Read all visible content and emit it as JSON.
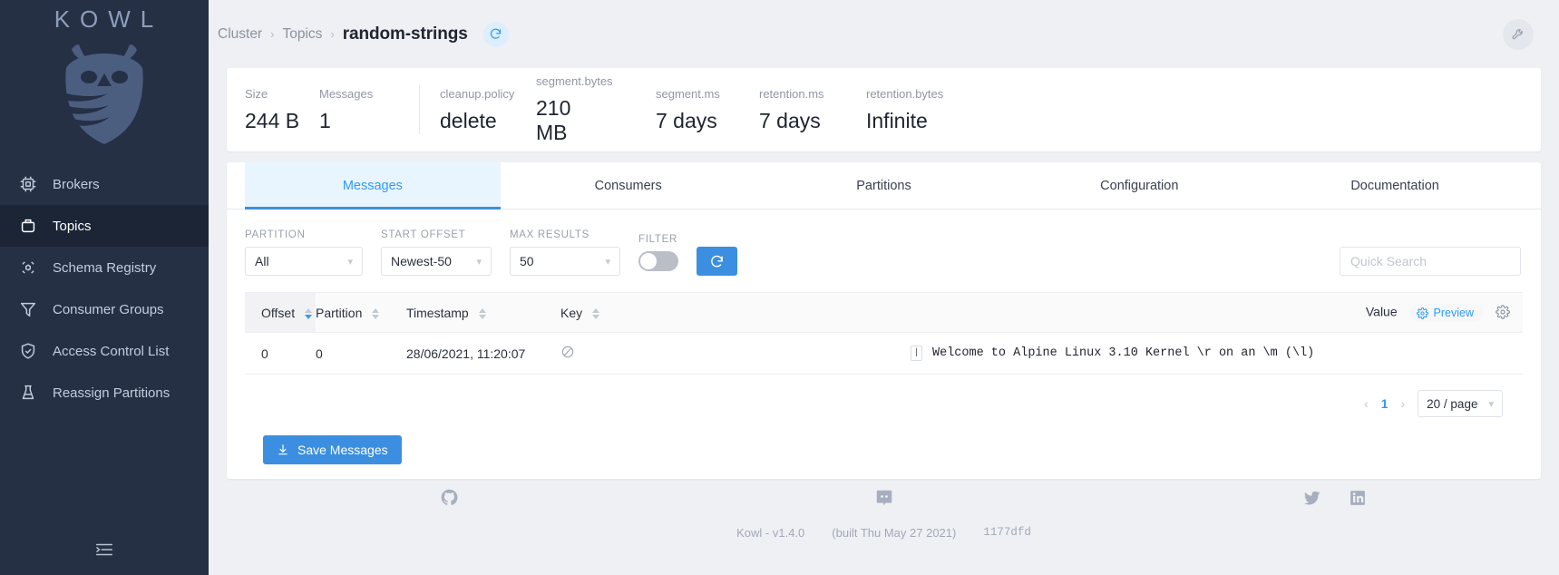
{
  "sidebar": {
    "logo_text": "KOWL",
    "logo_icon": "owl-shield-logo",
    "items": [
      {
        "label": "Brokers",
        "icon": "cpu-icon",
        "active": false
      },
      {
        "label": "Topics",
        "icon": "topics-icon",
        "active": true
      },
      {
        "label": "Schema Registry",
        "icon": "schema-registry-icon",
        "active": false
      },
      {
        "label": "Consumer Groups",
        "icon": "funnel-icon",
        "active": false
      },
      {
        "label": "Access Control List",
        "icon": "shield-check-icon",
        "active": false
      },
      {
        "label": "Reassign Partitions",
        "icon": "reassign-icon",
        "active": false
      }
    ],
    "collapse_icon": "collapse-sidebar-icon"
  },
  "topbar": {
    "breadcrumbs": [
      "Cluster",
      "Topics"
    ],
    "separator": "›",
    "current": "random-strings",
    "refresh_icon": "refresh-icon",
    "tools_icon": "wrench-icon"
  },
  "stats": [
    {
      "label": "Size",
      "value": "244 B"
    },
    {
      "label": "Messages",
      "value": "1"
    },
    {
      "label": "cleanup.policy",
      "value": "delete"
    },
    {
      "label": "segment.bytes",
      "value": "210 MB"
    },
    {
      "label": "segment.ms",
      "value": "7 days"
    },
    {
      "label": "retention.ms",
      "value": "7 days"
    },
    {
      "label": "retention.bytes",
      "value": "Infinite"
    }
  ],
  "tabs": [
    {
      "label": "Messages",
      "active": true
    },
    {
      "label": "Consumers",
      "active": false
    },
    {
      "label": "Partitions",
      "active": false
    },
    {
      "label": "Configuration",
      "active": false
    },
    {
      "label": "Documentation",
      "active": false
    }
  ],
  "filters": {
    "partition": {
      "label": "PARTITION",
      "value": "All"
    },
    "start_offset": {
      "label": "START OFFSET",
      "value": "Newest-50"
    },
    "max_results": {
      "label": "MAX RESULTS",
      "value": "50"
    },
    "filter": {
      "label": "FILTER",
      "enabled": false
    },
    "refresh_icon": "refresh-icon",
    "quick_search": {
      "value": "",
      "placeholder": "Quick Search"
    }
  },
  "table": {
    "columns": [
      {
        "label": "Offset",
        "sortable": true,
        "sorted": "desc"
      },
      {
        "label": "Partition",
        "sortable": true,
        "sorted": "none"
      },
      {
        "label": "Timestamp",
        "sortable": true,
        "sorted": "none"
      },
      {
        "label": "Key",
        "sortable": true,
        "sorted": "none"
      },
      {
        "label": "Value",
        "sortable": false,
        "sorted": "none"
      }
    ],
    "preview_label": "Preview",
    "preview_icon": "gear-icon",
    "settings_icon": "gear-icon",
    "rows": [
      {
        "offset": "0",
        "partition": "0",
        "timestamp": "28/06/2021, 11:20:07",
        "key": "",
        "key_icon": "null-circle-slash-icon",
        "value_type": "|",
        "value": "Welcome to Alpine Linux 3.10 Kernel \\r on an \\m (\\l)"
      }
    ]
  },
  "pagination": {
    "prev_icon": "chevron-left-icon",
    "next_icon": "chevron-right-icon",
    "current_page": "1",
    "page_size": "20 / page"
  },
  "actions": {
    "save_messages": "Save Messages",
    "save_icon": "download-icon"
  },
  "footer": {
    "icons": [
      "github-icon",
      "discord-icon",
      "twitter-icon",
      "linkedin-icon"
    ],
    "app_version": "Kowl - v1.4.0",
    "build_date": "(built Thu May 27 2021)",
    "commit": "1177dfd"
  },
  "colors": {
    "sidebar_bg": "#253045",
    "sidebar_active": "#1b2536",
    "accent": "#3c8fe0",
    "link": "#2f9bf4",
    "page_bg": "#eef0f4"
  }
}
